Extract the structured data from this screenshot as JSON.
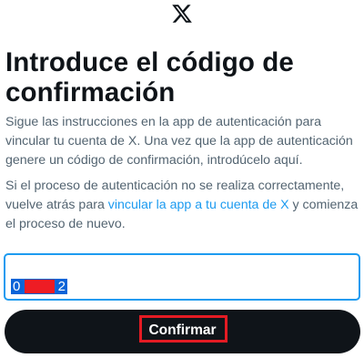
{
  "header": {
    "logo_icon": "x-logo-icon"
  },
  "main": {
    "title": "Introduce el código de confirmación",
    "instructions": "Sigue las instrucciones en la app de autenticación para vincular tu cuenta de X. Una vez que la app de autenticación genere un código de confirmación, introdúcelo aquí.",
    "help_prefix": "Si el proceso de autenticación no se realiza correctamente, vuelve atrás para ",
    "help_link": "vincular la app a tu cuenta de X",
    "help_suffix": " y comienza el proceso de nuevo."
  },
  "code_input": {
    "value_first": "0",
    "value_last": "2",
    "value_redacted": true
  },
  "confirm_button": {
    "label": "Confirmar"
  },
  "colors": {
    "text": "#0f1419",
    "secondary_text": "#536471",
    "link": "#1d9bf0",
    "input_focus_border": "#1d9bf0",
    "button_background": "#0f1419",
    "button_text": "#ffffff",
    "annotation_red": "#e41b23"
  }
}
